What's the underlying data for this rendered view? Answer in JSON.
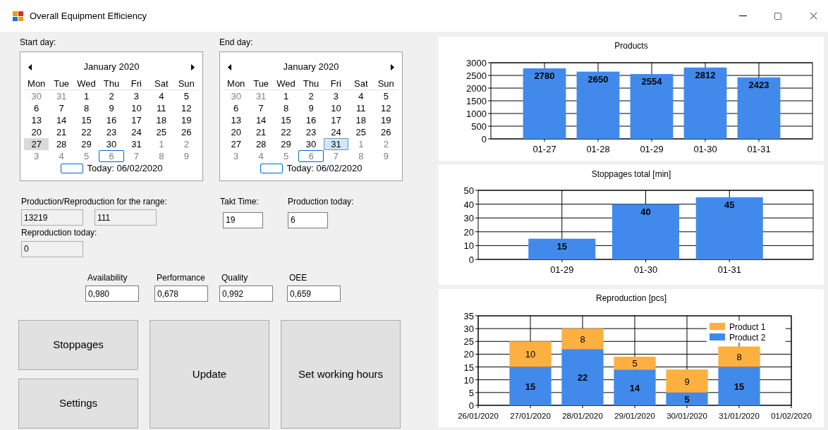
{
  "window": {
    "title": "Overall Equipment Efficiency"
  },
  "calendars": [
    {
      "label": "Start day:",
      "month": "January 2020",
      "focused": false,
      "weekdays": [
        "Mon",
        "Tue",
        "Wed",
        "Thu",
        "Fri",
        "Sat",
        "Sun"
      ],
      "weeks": [
        [
          {
            "d": "30",
            "in_month": false,
            "selected": false,
            "today": false
          },
          {
            "d": "31",
            "in_month": false,
            "selected": false,
            "today": false
          },
          {
            "d": "1",
            "in_month": true,
            "selected": false,
            "today": false
          },
          {
            "d": "2",
            "in_month": true,
            "selected": false,
            "today": false
          },
          {
            "d": "3",
            "in_month": true,
            "selected": false,
            "today": false
          },
          {
            "d": "4",
            "in_month": true,
            "selected": false,
            "today": false
          },
          {
            "d": "5",
            "in_month": true,
            "selected": false,
            "today": false
          }
        ],
        [
          {
            "d": "6",
            "in_month": true,
            "selected": false,
            "today": false
          },
          {
            "d": "7",
            "in_month": true,
            "selected": false,
            "today": false
          },
          {
            "d": "8",
            "in_month": true,
            "selected": false,
            "today": false
          },
          {
            "d": "9",
            "in_month": true,
            "selected": false,
            "today": false
          },
          {
            "d": "10",
            "in_month": true,
            "selected": false,
            "today": false
          },
          {
            "d": "11",
            "in_month": true,
            "selected": false,
            "today": false
          },
          {
            "d": "12",
            "in_month": true,
            "selected": false,
            "today": false
          }
        ],
        [
          {
            "d": "13",
            "in_month": true,
            "selected": false,
            "today": false
          },
          {
            "d": "14",
            "in_month": true,
            "selected": false,
            "today": false
          },
          {
            "d": "15",
            "in_month": true,
            "selected": false,
            "today": false
          },
          {
            "d": "16",
            "in_month": true,
            "selected": false,
            "today": false
          },
          {
            "d": "17",
            "in_month": true,
            "selected": false,
            "today": false
          },
          {
            "d": "18",
            "in_month": true,
            "selected": false,
            "today": false
          },
          {
            "d": "19",
            "in_month": true,
            "selected": false,
            "today": false
          }
        ],
        [
          {
            "d": "20",
            "in_month": true,
            "selected": false,
            "today": false
          },
          {
            "d": "21",
            "in_month": true,
            "selected": false,
            "today": false
          },
          {
            "d": "22",
            "in_month": true,
            "selected": false,
            "today": false
          },
          {
            "d": "23",
            "in_month": true,
            "selected": false,
            "today": false
          },
          {
            "d": "24",
            "in_month": true,
            "selected": false,
            "today": false
          },
          {
            "d": "25",
            "in_month": true,
            "selected": false,
            "today": false
          },
          {
            "d": "26",
            "in_month": true,
            "selected": false,
            "today": false
          }
        ],
        [
          {
            "d": "27",
            "in_month": true,
            "selected": true,
            "today": false
          },
          {
            "d": "28",
            "in_month": true,
            "selected": false,
            "today": false
          },
          {
            "d": "29",
            "in_month": true,
            "selected": false,
            "today": false
          },
          {
            "d": "30",
            "in_month": true,
            "selected": false,
            "today": false
          },
          {
            "d": "31",
            "in_month": true,
            "selected": false,
            "today": false
          },
          {
            "d": "1",
            "in_month": false,
            "selected": false,
            "today": false
          },
          {
            "d": "2",
            "in_month": false,
            "selected": false,
            "today": false
          }
        ],
        [
          {
            "d": "3",
            "in_month": false,
            "selected": false,
            "today": false
          },
          {
            "d": "4",
            "in_month": false,
            "selected": false,
            "today": false
          },
          {
            "d": "5",
            "in_month": false,
            "selected": false,
            "today": false
          },
          {
            "d": "6",
            "in_month": false,
            "selected": false,
            "today": true
          },
          {
            "d": "7",
            "in_month": false,
            "selected": false,
            "today": false
          },
          {
            "d": "8",
            "in_month": false,
            "selected": false,
            "today": false
          },
          {
            "d": "9",
            "in_month": false,
            "selected": false,
            "today": false
          }
        ]
      ],
      "today_label": "Today: 06/02/2020"
    },
    {
      "label": "End day:",
      "month": "January 2020",
      "focused": true,
      "weekdays": [
        "Mon",
        "Tue",
        "Wed",
        "Thu",
        "Fri",
        "Sat",
        "Sun"
      ],
      "weeks": [
        [
          {
            "d": "30",
            "in_month": false,
            "selected": false,
            "today": false
          },
          {
            "d": "31",
            "in_month": false,
            "selected": false,
            "today": false
          },
          {
            "d": "1",
            "in_month": true,
            "selected": false,
            "today": false
          },
          {
            "d": "2",
            "in_month": true,
            "selected": false,
            "today": false
          },
          {
            "d": "3",
            "in_month": true,
            "selected": false,
            "today": false
          },
          {
            "d": "4",
            "in_month": true,
            "selected": false,
            "today": false
          },
          {
            "d": "5",
            "in_month": true,
            "selected": false,
            "today": false
          }
        ],
        [
          {
            "d": "6",
            "in_month": true,
            "selected": false,
            "today": false
          },
          {
            "d": "7",
            "in_month": true,
            "selected": false,
            "today": false
          },
          {
            "d": "8",
            "in_month": true,
            "selected": false,
            "today": false
          },
          {
            "d": "9",
            "in_month": true,
            "selected": false,
            "today": false
          },
          {
            "d": "10",
            "in_month": true,
            "selected": false,
            "today": false
          },
          {
            "d": "11",
            "in_month": true,
            "selected": false,
            "today": false
          },
          {
            "d": "12",
            "in_month": true,
            "selected": false,
            "today": false
          }
        ],
        [
          {
            "d": "13",
            "in_month": true,
            "selected": false,
            "today": false
          },
          {
            "d": "14",
            "in_month": true,
            "selected": false,
            "today": false
          },
          {
            "d": "15",
            "in_month": true,
            "selected": false,
            "today": false
          },
          {
            "d": "16",
            "in_month": true,
            "selected": false,
            "today": false
          },
          {
            "d": "17",
            "in_month": true,
            "selected": false,
            "today": false
          },
          {
            "d": "18",
            "in_month": true,
            "selected": false,
            "today": false
          },
          {
            "d": "19",
            "in_month": true,
            "selected": false,
            "today": false
          }
        ],
        [
          {
            "d": "20",
            "in_month": true,
            "selected": false,
            "today": false
          },
          {
            "d": "21",
            "in_month": true,
            "selected": false,
            "today": false
          },
          {
            "d": "22",
            "in_month": true,
            "selected": false,
            "today": false
          },
          {
            "d": "23",
            "in_month": true,
            "selected": false,
            "today": false
          },
          {
            "d": "24",
            "in_month": true,
            "selected": false,
            "today": false
          },
          {
            "d": "25",
            "in_month": true,
            "selected": false,
            "today": false
          },
          {
            "d": "26",
            "in_month": true,
            "selected": false,
            "today": false
          }
        ],
        [
          {
            "d": "27",
            "in_month": true,
            "selected": false,
            "today": false
          },
          {
            "d": "28",
            "in_month": true,
            "selected": false,
            "today": false
          },
          {
            "d": "29",
            "in_month": true,
            "selected": false,
            "today": false
          },
          {
            "d": "30",
            "in_month": true,
            "selected": false,
            "today": false
          },
          {
            "d": "31",
            "in_month": true,
            "selected": true,
            "today": false
          },
          {
            "d": "1",
            "in_month": false,
            "selected": false,
            "today": false
          },
          {
            "d": "2",
            "in_month": false,
            "selected": false,
            "today": false
          }
        ],
        [
          {
            "d": "3",
            "in_month": false,
            "selected": false,
            "today": false
          },
          {
            "d": "4",
            "in_month": false,
            "selected": false,
            "today": false
          },
          {
            "d": "5",
            "in_month": false,
            "selected": false,
            "today": false
          },
          {
            "d": "6",
            "in_month": false,
            "selected": false,
            "today": true
          },
          {
            "d": "7",
            "in_month": false,
            "selected": false,
            "today": false
          },
          {
            "d": "8",
            "in_month": false,
            "selected": false,
            "today": false
          },
          {
            "d": "9",
            "in_month": false,
            "selected": false,
            "today": false
          }
        ]
      ],
      "today_label": "Today: 06/02/2020"
    }
  ],
  "range": {
    "label": "Production/Reproduction for the range:",
    "fields": [
      {
        "value": "13219",
        "read_only": true
      },
      {
        "value": "111",
        "read_only": true
      }
    ]
  },
  "reproduction_today": {
    "label": "Reproduction today:",
    "value": "0",
    "read_only": true
  },
  "takt_time": {
    "label": "Takt Time:",
    "value": "19",
    "read_only": false
  },
  "production_today": {
    "label": "Production today:",
    "value": "6",
    "read_only": false
  },
  "metrics": [
    {
      "label": "Availability",
      "value": "0,980",
      "read_only": false
    },
    {
      "label": "Performance",
      "value": "0,678",
      "read_only": false
    },
    {
      "label": "Quality",
      "value": "0,992",
      "read_only": false
    },
    {
      "label": "OEE",
      "value": "0,659",
      "read_only": false
    }
  ],
  "buttons": [
    {
      "label": "Stoppages"
    },
    {
      "label": "Settings"
    },
    {
      "label": "Update"
    },
    {
      "label": "Set working hours"
    }
  ],
  "charts": [
    {
      "chart_data": {
        "type": "bar",
        "title": "Products",
        "categories": [
          "01-27",
          "01-28",
          "01-29",
          "01-30",
          "01-31"
        ],
        "series": [
          {
            "color": "#418aec",
            "values": [
              2780,
              2650,
              2554,
              2812,
              2423
            ]
          }
        ],
        "grid": true,
        "ylim": [
          0,
          3000
        ],
        "yticks": [
          0,
          500,
          1000,
          1500,
          2000,
          2500,
          3000
        ],
        "data_labels": true
      }
    },
    {
      "chart_data": {
        "type": "bar",
        "title": "Stoppages total [min]",
        "categories": [
          "01-29",
          "01-30",
          "01-31"
        ],
        "series": [
          {
            "color": "#418aec",
            "values": [
              15,
              40,
              45
            ]
          }
        ],
        "grid": true,
        "ylim": [
          0,
          50
        ],
        "yticks": [
          0,
          10,
          20,
          30,
          40,
          50
        ],
        "data_labels": true
      }
    },
    {
      "chart_data": {
        "type": "bar",
        "title": "Reproduction [pcs]",
        "stacked": true,
        "categories": [
          "26/01/2020",
          "27/01/2020",
          "28/01/2020",
          "29/01/2020",
          "30/01/2020",
          "31/01/2020",
          "01/02/2020"
        ],
        "series": [
          {
            "name": "Product 1",
            "color": "#fbb03f",
            "values": [
              null,
              10,
              8,
              5,
              9,
              8,
              null
            ]
          },
          {
            "name": "Product 2",
            "color": "#418aec",
            "values": [
              null,
              15,
              22,
              14,
              5,
              15,
              null
            ]
          }
        ],
        "grid": true,
        "legend": true,
        "ylim": [
          0,
          35
        ],
        "yticks": [
          0,
          5,
          10,
          15,
          20,
          25,
          30,
          35
        ],
        "data_labels": true
      }
    }
  ]
}
